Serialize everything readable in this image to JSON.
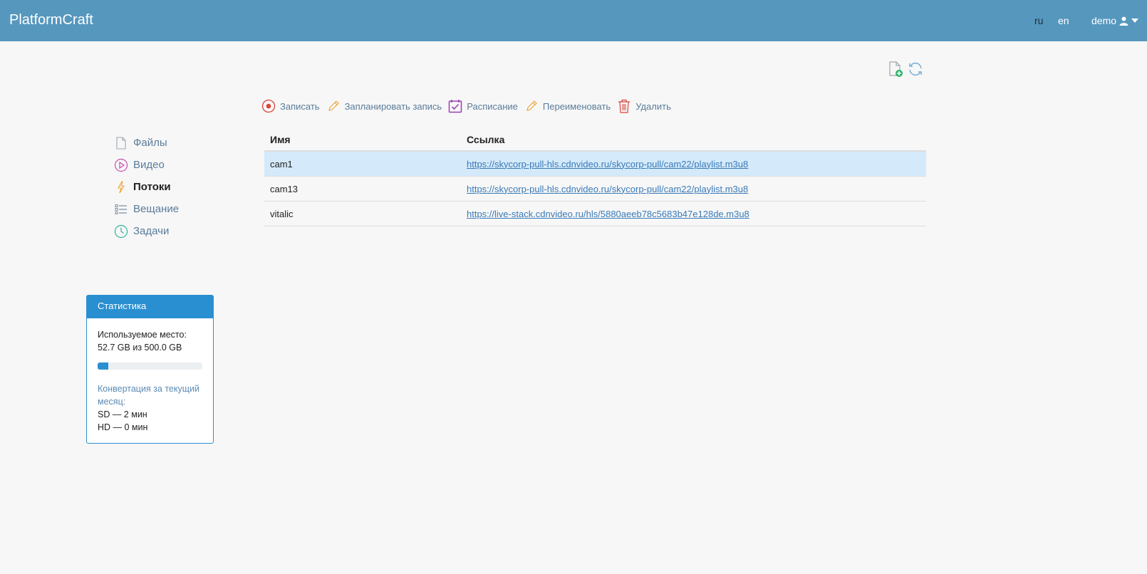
{
  "header": {
    "brand": "PlatformCraft",
    "lang_ru": "ru",
    "lang_en": "en",
    "user": "demo"
  },
  "toolbar": {
    "record": "Записать",
    "schedule_record": "Запланировать запись",
    "schedule": "Расписание",
    "rename": "Переименовать",
    "delete": "Удалить"
  },
  "sidebar": {
    "items": [
      {
        "label": "Файлы",
        "icon": "file-icon"
      },
      {
        "label": "Видео",
        "icon": "play-icon"
      },
      {
        "label": "Потоки",
        "icon": "lightning-icon"
      },
      {
        "label": "Вещание",
        "icon": "list-icon"
      },
      {
        "label": "Задачи",
        "icon": "clock-icon"
      }
    ]
  },
  "table": {
    "headers": {
      "name": "Имя",
      "link": "Ссылка"
    },
    "rows": [
      {
        "name": "cam1",
        "link": "https://skycorp-pull-hls.cdnvideo.ru/skycorp-pull/cam22/playlist.m3u8"
      },
      {
        "name": "cam13",
        "link": "https://skycorp-pull-hls.cdnvideo.ru/skycorp-pull/cam22/playlist.m3u8"
      },
      {
        "name": "vitalic",
        "link": "https://live-stack.cdnvideo.ru/hls/5880aeeb78c5683b47e128de.m3u8"
      }
    ]
  },
  "stats": {
    "title": "Статистика",
    "used_label": "Используемое место:",
    "used_value": "52.7 GB из 500.0 GB",
    "used_fraction": 0.105,
    "conv_label": "Конвертация за текущий месяц:",
    "sd": "SD — 2 мин",
    "hd": "HD — 0 мин"
  },
  "colors": {
    "navbar": "#5697bd",
    "accent": "#2a8fd0",
    "selected_row": "#d4eafa"
  }
}
